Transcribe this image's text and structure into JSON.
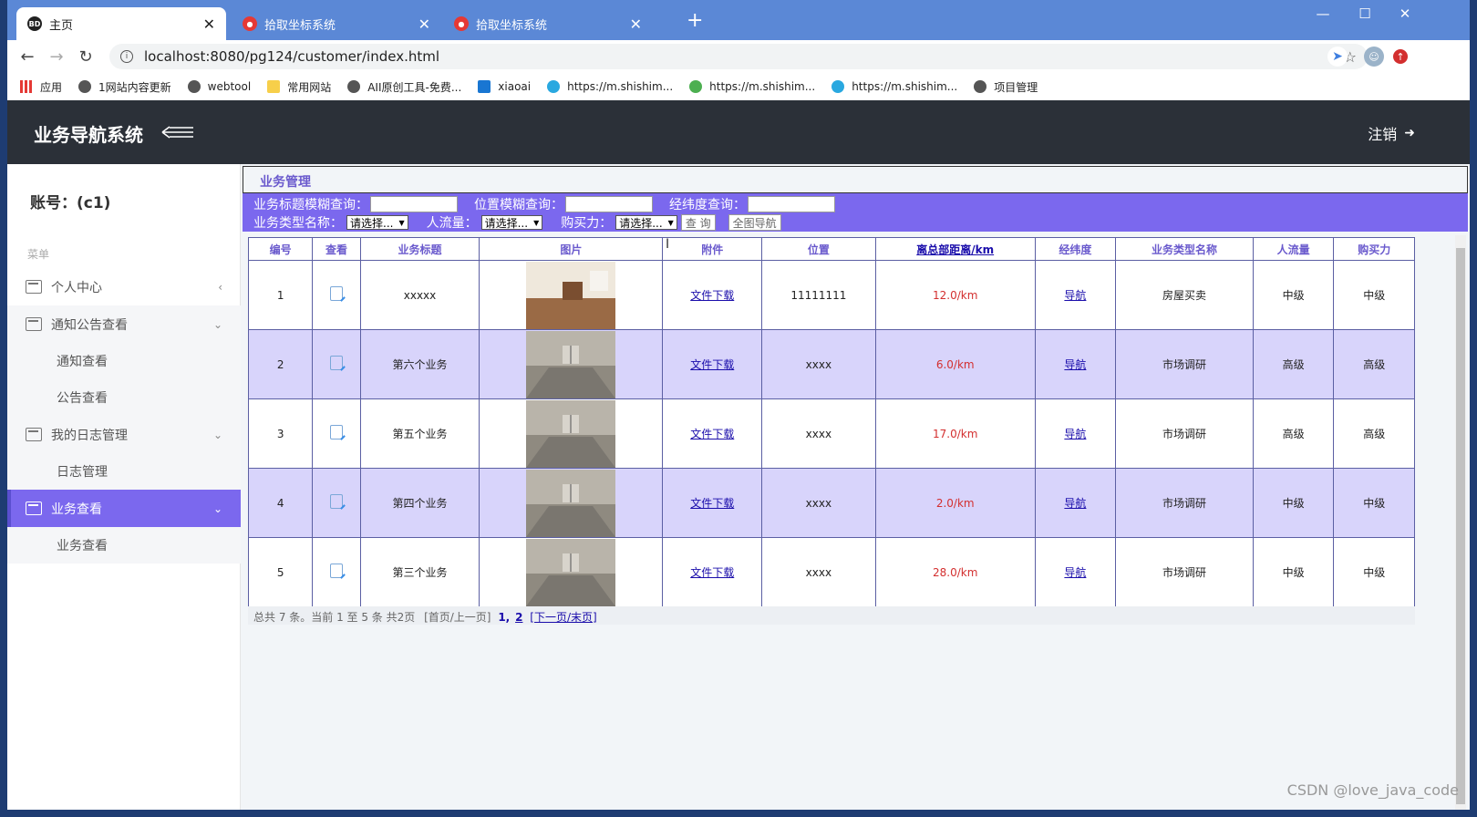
{
  "browser": {
    "tabs": [
      {
        "title": "主页",
        "active": true
      },
      {
        "title": "拾取坐标系统",
        "active": false
      },
      {
        "title": "拾取坐标系统",
        "active": false
      }
    ],
    "url": "localhost:8080/pg124/customer/index.html",
    "bookmarks": [
      "应用",
      "1网站内容更新",
      "webtool",
      "常用网站",
      "AII原创工具-免费...",
      "xiaoai",
      "https://m.shishim...",
      "https://m.shishim...",
      "https://m.shishim...",
      "项目管理"
    ]
  },
  "app": {
    "name": "业务导航系统",
    "logout": "注销",
    "account": "账号：(c1)",
    "menu_header": "菜单"
  },
  "sidebar": {
    "items": [
      {
        "label": "个人中心"
      },
      {
        "label": "通知公告查看"
      },
      {
        "label": "通知查看"
      },
      {
        "label": "公告查看"
      },
      {
        "label": "我的日志管理"
      },
      {
        "label": "日志管理"
      },
      {
        "label": "业务查看"
      },
      {
        "label": "业务查看"
      }
    ]
  },
  "panel": {
    "title": "业务管理"
  },
  "search": {
    "title_label": "业务标题模糊查询：",
    "position_label": "位置模糊查询：",
    "lnglat_label": "经纬度查询：",
    "type_label": "业务类型名称：",
    "flow_label": "人流量：",
    "buy_label": "购买力：",
    "select_placeholder": "请选择...",
    "query_button": "查 询",
    "fullmap_button": "全图导航"
  },
  "table": {
    "headers": [
      "编号",
      "查看",
      "业务标题",
      "图片",
      "附件",
      "位置",
      "离总部距离/km",
      "经纬度",
      "业务类型名称",
      "人流量",
      "购买力"
    ],
    "download_label": "文件下载",
    "nav_label": "导航",
    "rows": [
      {
        "id": "1",
        "title": "xxxxx",
        "position": "11111111",
        "distance": "12.0/km",
        "type": "房屋买卖",
        "flow": "中级",
        "buy": "中级"
      },
      {
        "id": "2",
        "title": "第六个业务",
        "position": "xxxx",
        "distance": "6.0/km",
        "type": "市场调研",
        "flow": "高级",
        "buy": "高级"
      },
      {
        "id": "3",
        "title": "第五个业务",
        "position": "xxxx",
        "distance": "17.0/km",
        "type": "市场调研",
        "flow": "高级",
        "buy": "高级"
      },
      {
        "id": "4",
        "title": "第四个业务",
        "position": "xxxx",
        "distance": "2.0/km",
        "type": "市场调研",
        "flow": "中级",
        "buy": "中级"
      },
      {
        "id": "5",
        "title": "第三个业务",
        "position": "xxxx",
        "distance": "28.0/km",
        "type": "市场调研",
        "flow": "中级",
        "buy": "中级"
      }
    ]
  },
  "pager": {
    "summary": "总共 7 条。当前 1 至 5 条 共2页",
    "first_prev": "[首页/上一页]",
    "page1": "1,",
    "page2": "2",
    "next_last": "[下一页/末页]"
  },
  "watermark": "CSDN @love_java_code",
  "colors": {
    "accent": "#7b68ee",
    "header_bg": "#2b3038",
    "alt_row": "#d8d4fb",
    "distance": "#d32f2f"
  }
}
